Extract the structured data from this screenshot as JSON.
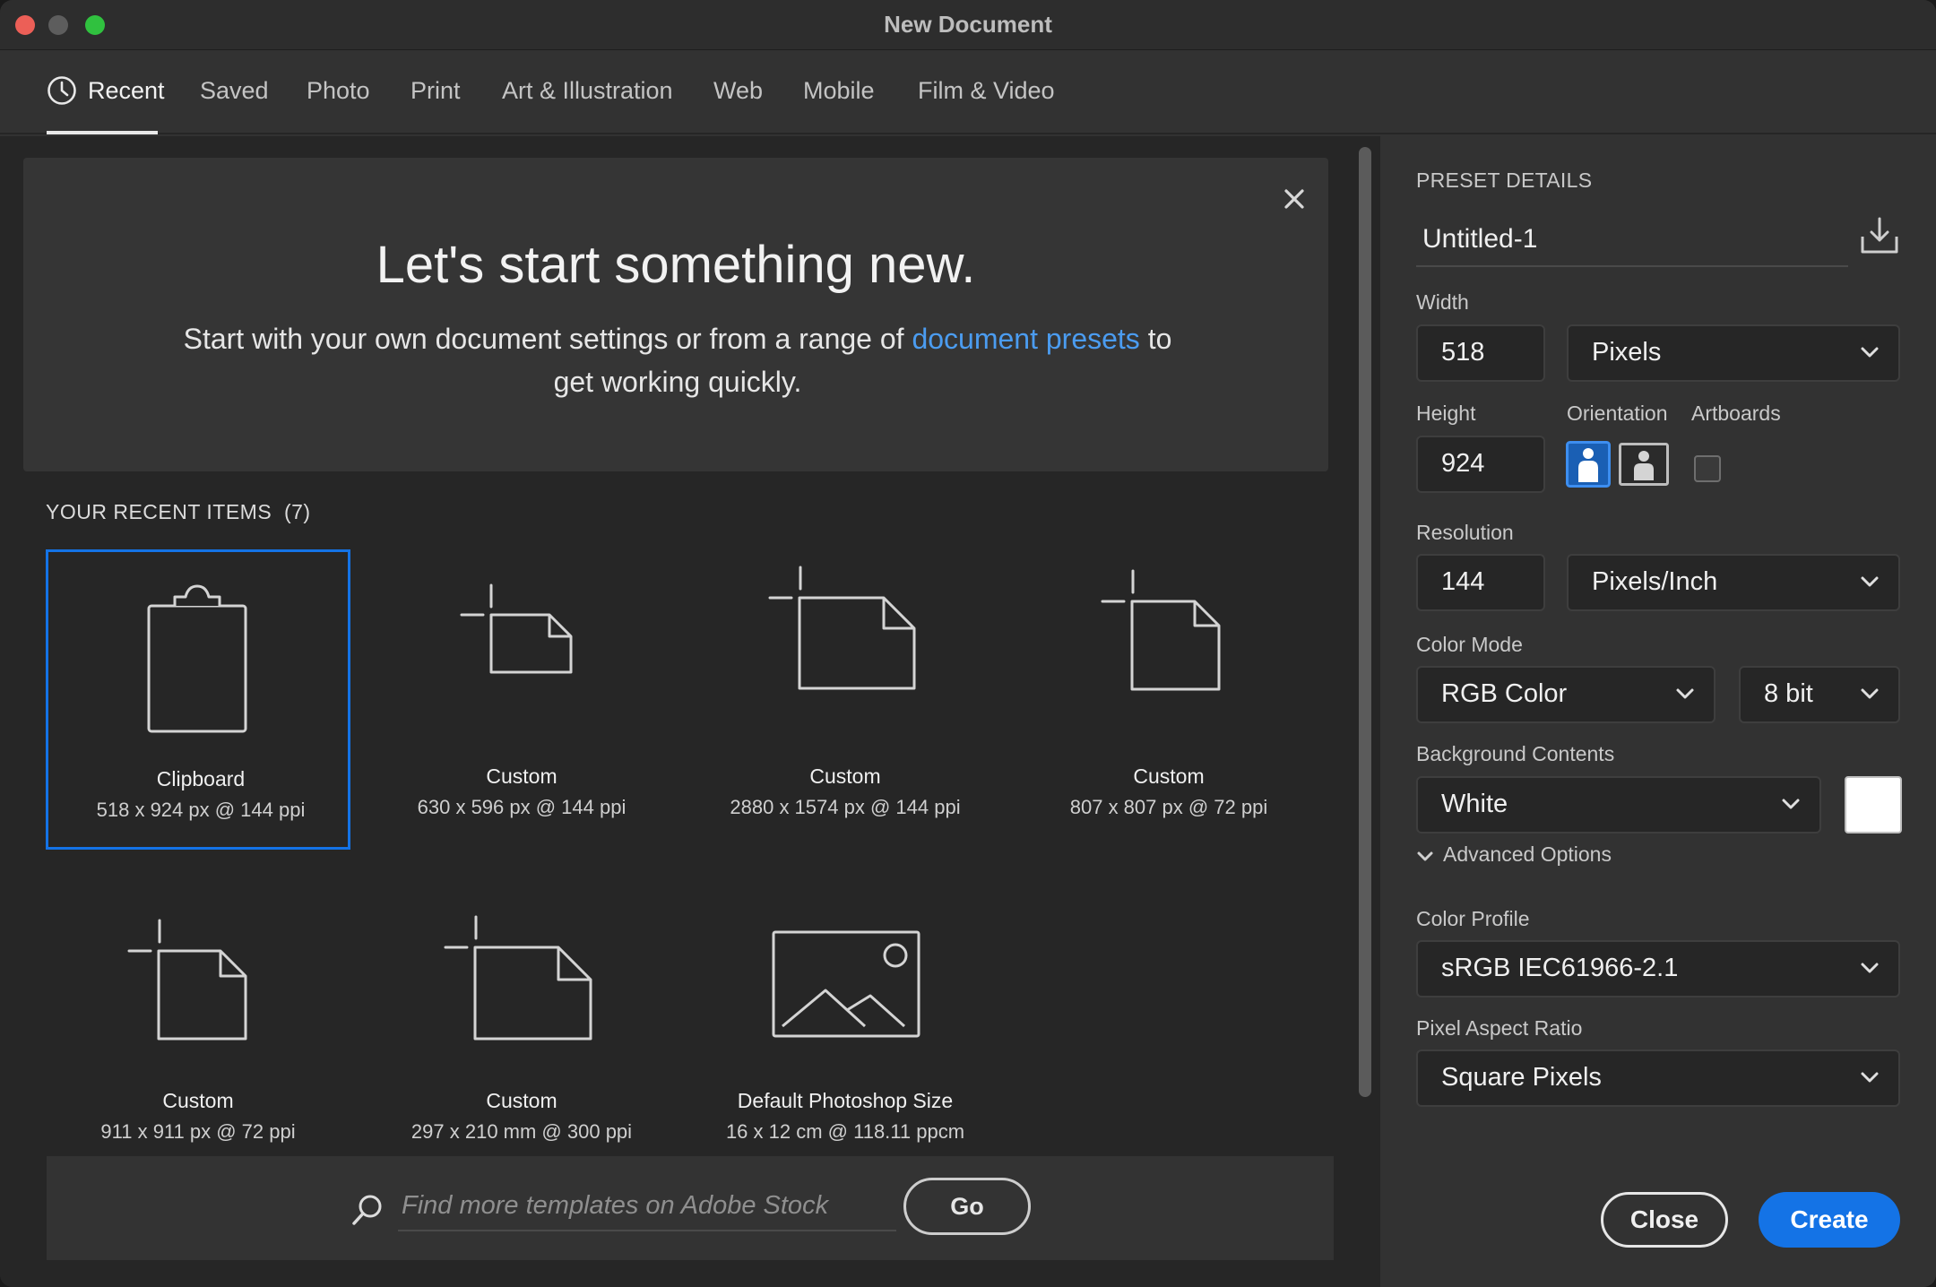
{
  "window": {
    "title": "New Document"
  },
  "tabs": [
    {
      "label": "Recent",
      "active": true
    },
    {
      "label": "Saved"
    },
    {
      "label": "Photo"
    },
    {
      "label": "Print"
    },
    {
      "label": "Art & Illustration"
    },
    {
      "label": "Web"
    },
    {
      "label": "Mobile"
    },
    {
      "label": "Film & Video"
    }
  ],
  "banner": {
    "title": "Let's start something new.",
    "sub_before": "Start with your own document settings or from a range of ",
    "sub_link": "document presets",
    "sub_after": " to get working quickly."
  },
  "recent": {
    "header": "YOUR RECENT ITEMS",
    "count": "(7)",
    "items": [
      {
        "name": "Clipboard",
        "meta": "518 x 924 px @ 144 ppi",
        "icon": "clipboard-icon",
        "selected": true
      },
      {
        "name": "Custom",
        "meta": "630 x 596 px @ 144 ppi",
        "icon": "document-icon"
      },
      {
        "name": "Custom",
        "meta": "2880 x 1574 px @ 144 ppi",
        "icon": "document-icon"
      },
      {
        "name": "Custom",
        "meta": "807 x 807 px @ 72 ppi",
        "icon": "document-icon"
      },
      {
        "name": "Custom",
        "meta": "911 x 911 px @ 72 ppi",
        "icon": "document-icon"
      },
      {
        "name": "Custom",
        "meta": "297 x 210 mm @ 300 ppi",
        "icon": "document-icon"
      },
      {
        "name": "Default Photoshop Size",
        "meta": "16 x 12 cm @ 118.11 ppcm",
        "icon": "image-icon"
      }
    ]
  },
  "search": {
    "placeholder": "Find more templates on Adobe Stock",
    "go_label": "Go"
  },
  "preset": {
    "section_title": "PRESET DETAILS",
    "name": "Untitled-1",
    "width_label": "Width",
    "width_value": "518",
    "width_unit": "Pixels",
    "height_label": "Height",
    "height_value": "924",
    "orientation_label": "Orientation",
    "artboards_label": "Artboards",
    "resolution_label": "Resolution",
    "resolution_value": "144",
    "resolution_unit": "Pixels/Inch",
    "color_mode_label": "Color Mode",
    "color_mode": "RGB Color",
    "bit_depth": "8 bit",
    "background_label": "Background Contents",
    "background": "White",
    "advanced_label": "Advanced Options",
    "color_profile_label": "Color Profile",
    "color_profile": "sRGB IEC61966-2.1",
    "pixel_aspect_label": "Pixel Aspect Ratio",
    "pixel_aspect": "Square Pixels"
  },
  "actions": {
    "close": "Close",
    "create": "Create"
  },
  "colors": {
    "accent": "#1473e6",
    "link": "#4b9cf0",
    "background_swatch": "#ffffff"
  }
}
